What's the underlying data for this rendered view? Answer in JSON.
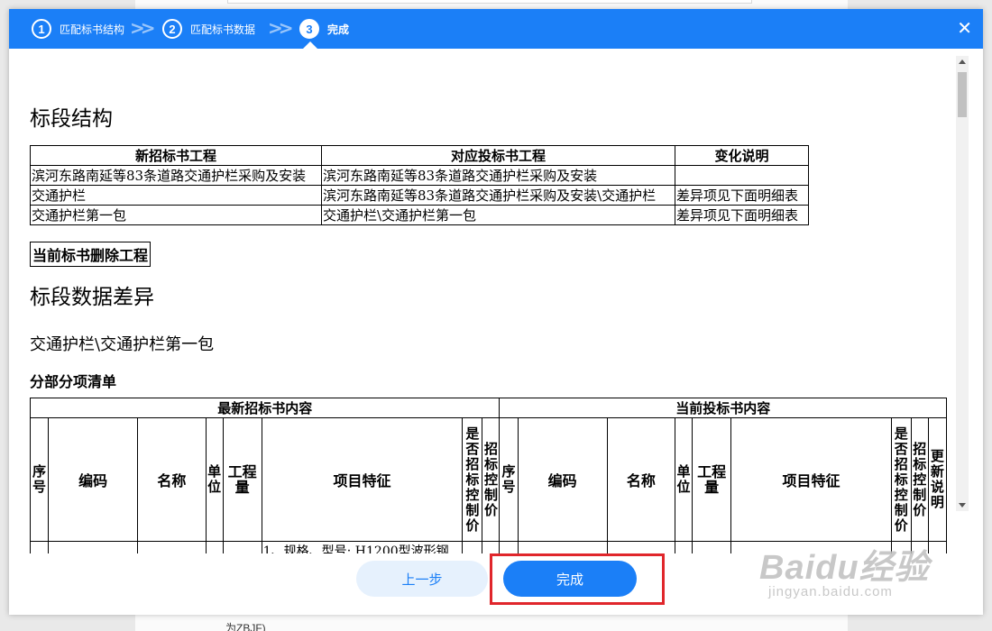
{
  "wizard": {
    "steps": [
      {
        "num": "1",
        "label": "匹配标书结构"
      },
      {
        "num": "2",
        "label": "匹配标书数据"
      },
      {
        "num": "3",
        "label": "完成"
      }
    ],
    "close_icon": "close-icon"
  },
  "content": {
    "section1_title": "标段结构",
    "structure_table": {
      "headers": [
        "新招标书工程",
        "对应投标书工程",
        "变化说明"
      ],
      "rows": [
        [
          "滨河东路南延等83条道路交通护栏采购及安装",
          "滨河东路南延等83条道路交通护栏采购及安装",
          ""
        ],
        [
          "交通护栏",
          "滨河东路南延等83条道路交通护栏采购及安装\\交通护栏",
          "差异项见下面明细表"
        ],
        [
          "交通护栏第一包",
          "交通护栏\\交通护栏第一包",
          "差异项见下面明细表"
        ]
      ]
    },
    "delete_label": "当前标书删除工程",
    "section2_title": "标段数据差异",
    "package_title": "交通护栏\\交通护栏第一包",
    "list_title": "分部分项清单",
    "diff_table": {
      "group_left": "最新招标书内容",
      "group_right": "当前投标书内容",
      "cols_left": [
        "序号",
        "编码",
        "名称",
        "单位",
        "工程量",
        "项目特征",
        "是否招标控制价",
        "招标控制价"
      ],
      "cols_right": [
        "序号",
        "编码",
        "名称",
        "单位",
        "工程量",
        "项目特征",
        "是否招标控制价",
        "招标控制价",
        "更新说明"
      ],
      "partial_row_text": "1、规格、型号: H1200型波形钢"
    }
  },
  "footer": {
    "prev_label": "上一步",
    "done_label": "完成"
  },
  "background": {
    "bottom_text": "为ZBJF)"
  },
  "watermark": {
    "logo": "Baidu经验",
    "url": "jingyan.baidu.com"
  },
  "colors": {
    "header_blue": "#1b7ff7",
    "prev_button_bg": "#e6f1fd",
    "highlight_red": "#e0262b"
  }
}
